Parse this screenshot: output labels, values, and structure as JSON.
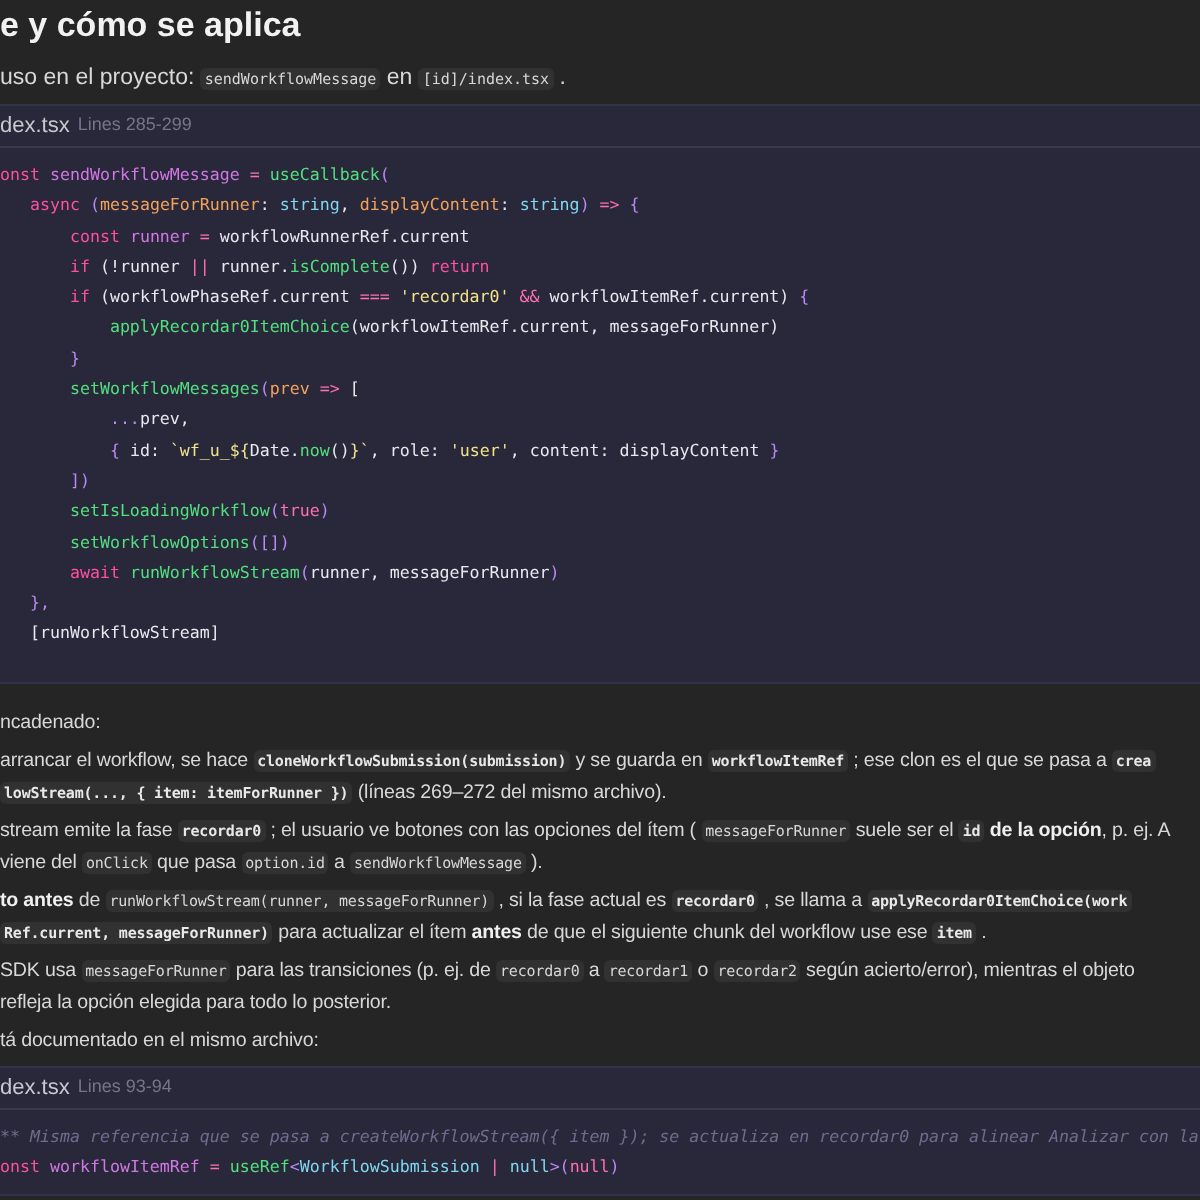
{
  "heading": "e y cómo se aplica",
  "intro": [
    {
      "kind": "text",
      "text": "uso en el proyecto: "
    },
    {
      "kind": "code",
      "text": "sendWorkflowMessage"
    },
    {
      "kind": "text",
      "text": " en "
    },
    {
      "kind": "code",
      "text": "[id]/index.tsx"
    },
    {
      "kind": "text",
      "text": " ."
    }
  ],
  "code_block_1": {
    "file": "dex.tsx",
    "lines_label": "Lines 285-299",
    "lines": [
      [
        {
          "kind": "kw",
          "text": "onst"
        },
        {
          "kind": "var",
          "text": " sendWorkflowMessage"
        },
        {
          "kind": "op",
          "text": " = "
        },
        {
          "kind": "fn",
          "text": "useCallback"
        },
        {
          "kind": "punc",
          "text": "("
        }
      ],
      [
        {
          "kind": "kw",
          "text": "   async"
        },
        {
          "kind": "punc",
          "text": " ("
        },
        {
          "kind": "param",
          "text": "messageForRunner"
        },
        {
          "kind": "plain",
          "text": ": "
        },
        {
          "kind": "type",
          "text": "string"
        },
        {
          "kind": "plain",
          "text": ", "
        },
        {
          "kind": "param",
          "text": "displayContent"
        },
        {
          "kind": "plain",
          "text": ": "
        },
        {
          "kind": "type",
          "text": "string"
        },
        {
          "kind": "punc",
          "text": ")"
        },
        {
          "kind": "op",
          "text": " => "
        },
        {
          "kind": "punc",
          "text": "{"
        }
      ],
      [
        {
          "kind": "kw",
          "text": "       const"
        },
        {
          "kind": "var",
          "text": " runner"
        },
        {
          "kind": "op",
          "text": " = "
        },
        {
          "kind": "plain",
          "text": "workflowRunnerRef.current"
        }
      ],
      [
        {
          "kind": "kw",
          "text": "       if"
        },
        {
          "kind": "plain",
          "text": " (!runner "
        },
        {
          "kind": "op",
          "text": "||"
        },
        {
          "kind": "plain",
          "text": " runner."
        },
        {
          "kind": "fn",
          "text": "isComplete"
        },
        {
          "kind": "plain",
          "text": "()) "
        },
        {
          "kind": "kw",
          "text": "return"
        }
      ],
      [
        {
          "kind": "kw",
          "text": "       if"
        },
        {
          "kind": "plain",
          "text": " (workflowPhaseRef.current "
        },
        {
          "kind": "op",
          "text": "==="
        },
        {
          "kind": "str",
          "text": " 'recordar0'"
        },
        {
          "kind": "op",
          "text": " &&"
        },
        {
          "kind": "plain",
          "text": " workflowItemRef.current) "
        },
        {
          "kind": "punc",
          "text": "{"
        }
      ],
      [
        {
          "kind": "fn",
          "text": "           applyRecordar0ItemChoice"
        },
        {
          "kind": "plain",
          "text": "(workflowItemRef.current, messageForRunner)"
        }
      ],
      [
        {
          "kind": "punc",
          "text": "       }"
        }
      ],
      [
        {
          "kind": "fn",
          "text": "       setWorkflowMessages"
        },
        {
          "kind": "punc",
          "text": "("
        },
        {
          "kind": "param",
          "text": "prev"
        },
        {
          "kind": "op",
          "text": " => "
        },
        {
          "kind": "plain",
          "text": "["
        }
      ],
      [
        {
          "kind": "punc",
          "text": "           ..."
        },
        {
          "kind": "plain",
          "text": "prev,"
        }
      ],
      [
        {
          "kind": "punc",
          "text": "           {"
        },
        {
          "kind": "plain",
          "text": " id: "
        },
        {
          "kind": "str",
          "text": "`wf_u_${"
        },
        {
          "kind": "plain",
          "text": "Date."
        },
        {
          "kind": "fn",
          "text": "now"
        },
        {
          "kind": "plain",
          "text": "()"
        },
        {
          "kind": "str",
          "text": "}`"
        },
        {
          "kind": "plain",
          "text": ", role: "
        },
        {
          "kind": "str",
          "text": "'user'"
        },
        {
          "kind": "plain",
          "text": ", content: displayContent "
        },
        {
          "kind": "punc",
          "text": "}"
        }
      ],
      [
        {
          "kind": "punc",
          "text": "       ])"
        }
      ],
      [
        {
          "kind": "fn",
          "text": "       setIsLoadingWorkflow"
        },
        {
          "kind": "punc",
          "text": "("
        },
        {
          "kind": "bool",
          "text": "true"
        },
        {
          "kind": "punc",
          "text": ")"
        }
      ],
      [
        {
          "kind": "fn",
          "text": "       setWorkflowOptions"
        },
        {
          "kind": "punc",
          "text": "([])"
        }
      ],
      [
        {
          "kind": "kw",
          "text": "       await"
        },
        {
          "kind": "fn",
          "text": " runWorkflowStream"
        },
        {
          "kind": "punc",
          "text": "("
        },
        {
          "kind": "plain",
          "text": "runner, messageForRunner"
        },
        {
          "kind": "punc",
          "text": ")"
        }
      ],
      [
        {
          "kind": "punc",
          "text": "   },"
        }
      ],
      [
        {
          "kind": "plain",
          "text": "   [runWorkflowStream]"
        }
      ]
    ]
  },
  "paragraphs": [
    [
      [
        {
          "kind": "text",
          "text": "ncadenado:"
        }
      ]
    ],
    [
      [
        {
          "kind": "text",
          "text": "arrancar el workflow, se hace "
        },
        {
          "kind": "code_bold",
          "text": "cloneWorkflowSubmission(submission)"
        },
        {
          "kind": "text",
          "text": " y se guarda en "
        },
        {
          "kind": "code_bold",
          "text": "workflowItemRef"
        },
        {
          "kind": "text",
          "text": " ; ese clon es el que se pasa a "
        },
        {
          "kind": "code_bold",
          "text": "crea"
        }
      ],
      [
        {
          "kind": "code_bold",
          "text": "lowStream(..., { item: itemForRunner })"
        },
        {
          "kind": "text",
          "text": " (líneas 269–272 del mismo archivo)."
        }
      ]
    ],
    [
      [
        {
          "kind": "text",
          "text": "stream emite la fase "
        },
        {
          "kind": "code_bold",
          "text": "recordar0"
        },
        {
          "kind": "text",
          "text": " ; el usuario ve botones con las opciones del ítem ( "
        },
        {
          "kind": "code",
          "text": "messageForRunner"
        },
        {
          "kind": "text",
          "text": " suele ser el "
        },
        {
          "kind": "code_bold",
          "text": "id"
        },
        {
          "kind": "bold",
          "text": " de la opción"
        },
        {
          "kind": "text",
          "text": ", p. ej. A"
        }
      ],
      [
        {
          "kind": "text",
          "text": "viene del "
        },
        {
          "kind": "code",
          "text": "onClick"
        },
        {
          "kind": "text",
          "text": " que pasa "
        },
        {
          "kind": "code",
          "text": "option.id"
        },
        {
          "kind": "text",
          "text": " a "
        },
        {
          "kind": "code",
          "text": "sendWorkflowMessage"
        },
        {
          "kind": "text",
          "text": " )."
        }
      ]
    ],
    [
      [
        {
          "kind": "bold",
          "text": "to antes"
        },
        {
          "kind": "text",
          "text": " de "
        },
        {
          "kind": "code",
          "text": "runWorkflowStream(runner, messageForRunner)"
        },
        {
          "kind": "text",
          "text": " , si la fase actual es "
        },
        {
          "kind": "code_bold",
          "text": "recordar0"
        },
        {
          "kind": "text",
          "text": " , se llama a "
        },
        {
          "kind": "code_bold",
          "text": "applyRecordar0ItemChoice(work"
        }
      ],
      [
        {
          "kind": "code_bold",
          "text": "Ref.current, messageForRunner)"
        },
        {
          "kind": "text",
          "text": " para actualizar el ítem "
        },
        {
          "kind": "bold",
          "text": "antes"
        },
        {
          "kind": "text",
          "text": " de que el siguiente chunk del workflow use ese "
        },
        {
          "kind": "code_bold",
          "text": "item"
        },
        {
          "kind": "text",
          "text": " ."
        }
      ]
    ],
    [
      [
        {
          "kind": "text",
          "text": "SDK usa "
        },
        {
          "kind": "code",
          "text": "messageForRunner"
        },
        {
          "kind": "text",
          "text": " para las transiciones (p. ej. de "
        },
        {
          "kind": "code",
          "text": "recordar0"
        },
        {
          "kind": "text",
          "text": " a "
        },
        {
          "kind": "code",
          "text": "recordar1"
        },
        {
          "kind": "text",
          "text": " o "
        },
        {
          "kind": "code",
          "text": "recordar2"
        },
        {
          "kind": "text",
          "text": " según acierto/error), mientras el objeto"
        }
      ],
      [
        {
          "kind": "text",
          "text": "refleja la opción elegida para todo lo posterior."
        }
      ]
    ],
    [
      [
        {
          "kind": "text",
          "text": "tá documentado en el mismo archivo:"
        }
      ]
    ]
  ],
  "code_block_2": {
    "file": "dex.tsx",
    "lines_label": "Lines 93-94",
    "lines": [
      [
        {
          "kind": "comment",
          "text": "** Misma referencia que se pasa a createWorkflowStream({ item }); se actualiza en recordar0 para alinear Analizar con la"
        }
      ],
      [
        {
          "kind": "kw",
          "text": "onst"
        },
        {
          "kind": "var",
          "text": " workflowItemRef"
        },
        {
          "kind": "op",
          "text": " = "
        },
        {
          "kind": "fn",
          "text": "useRef"
        },
        {
          "kind": "punc",
          "text": "<"
        },
        {
          "kind": "type",
          "text": "WorkflowSubmission"
        },
        {
          "kind": "op",
          "text": " | "
        },
        {
          "kind": "type",
          "text": "null"
        },
        {
          "kind": "punc",
          "text": ">("
        },
        {
          "kind": "bool",
          "text": "null"
        },
        {
          "kind": "punc",
          "text": ")"
        }
      ]
    ]
  }
}
